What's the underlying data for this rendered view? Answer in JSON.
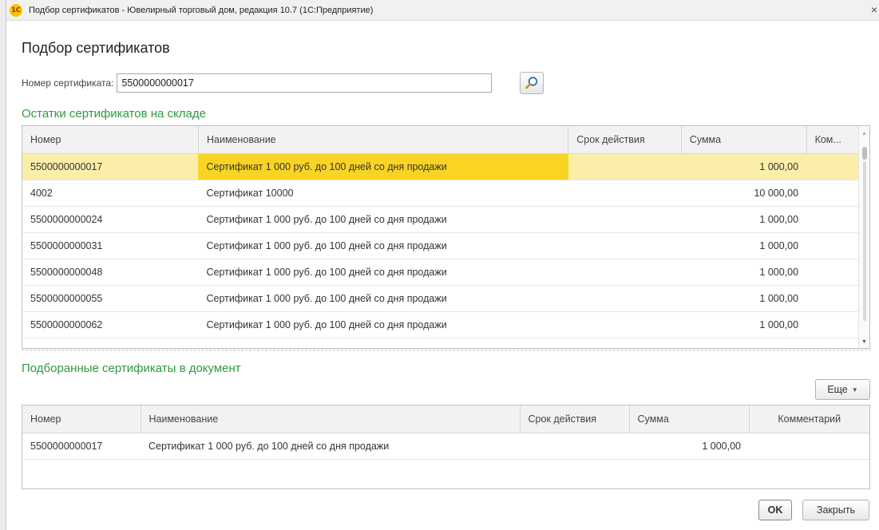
{
  "window": {
    "title": "Подбор сертификатов - Ювелирный торговый дом, редакция 10.7  (1С:Предприятие)",
    "logo_text": "1С",
    "close_glyph": "×"
  },
  "form": {
    "title": "Подбор сертификатов"
  },
  "search": {
    "label": "Номер сертификата:",
    "value": "5500000000017"
  },
  "stock_section": {
    "title": "Остатки сертификатов на складе",
    "columns": [
      "Номер",
      "Наименование",
      "Срок действия",
      "Сумма",
      "Ком..."
    ],
    "rows": [
      {
        "number": "5500000000017",
        "name": "Сертификат 1 000 руб. до 100 дней со дня продажи",
        "term": "",
        "sum": "1 000,00",
        "comment": ""
      },
      {
        "number": "4002",
        "name": "Сертификат 10000",
        "term": "",
        "sum": "10 000,00",
        "comment": ""
      },
      {
        "number": "5500000000024",
        "name": "Сертификат 1 000 руб. до 100 дней со дня продажи",
        "term": "",
        "sum": "1 000,00",
        "comment": ""
      },
      {
        "number": "5500000000031",
        "name": "Сертификат 1 000 руб. до 100 дней со дня продажи",
        "term": "",
        "sum": "1 000,00",
        "comment": ""
      },
      {
        "number": "5500000000048",
        "name": "Сертификат 1 000 руб. до 100 дней со дня продажи",
        "term": "",
        "sum": "1 000,00",
        "comment": ""
      },
      {
        "number": "5500000000055",
        "name": "Сертификат 1 000 руб. до 100 дней со дня продажи",
        "term": "",
        "sum": "1 000,00",
        "comment": ""
      },
      {
        "number": "5500000000062",
        "name": "Сертификат 1 000 руб. до 100 дней со дня продажи",
        "term": "",
        "sum": "1 000,00",
        "comment": ""
      }
    ]
  },
  "selected_section": {
    "title": "Подборанные сертификаты в документ",
    "more_button": "Еще",
    "columns": [
      "Номер",
      "Наименование",
      "Срок действия",
      "Сумма",
      "Комментарий"
    ],
    "rows": [
      {
        "number": "5500000000017",
        "name": "Сертификат 1 000 руб. до 100 дней со дня продажи",
        "term": "",
        "sum": "1 000,00",
        "comment": ""
      }
    ]
  },
  "footer": {
    "ok_label": "OK",
    "close_label": "Закрыть"
  },
  "colors": {
    "section_title": "#2e9a3f",
    "selected_row": "#fbeea8",
    "selected_cell": "#f9d423"
  }
}
